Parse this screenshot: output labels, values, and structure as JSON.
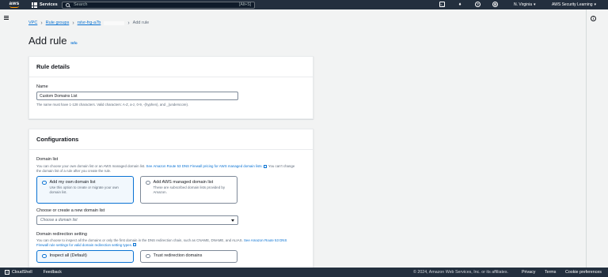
{
  "topnav": {
    "logo": "aws",
    "services": "Services",
    "search_placeholder": "Search",
    "search_shortcut": "[Alt+S]",
    "region": "N. Virginia",
    "account": "AWS Security Learning"
  },
  "breadcrumb": {
    "items": [
      "VPC",
      "Rule groups",
      "rslvr-frg-a7b"
    ],
    "current": "Add rule"
  },
  "page": {
    "title": "Add rule",
    "info": "Info"
  },
  "rule_details": {
    "heading": "Rule details",
    "name_label": "Name",
    "name_value": "Custom Domains List",
    "name_constraint": "The name must have 1-128 characters. Valid characters: A-Z, a-z, 0-9, -(hyphen), and _(underscore)."
  },
  "configurations": {
    "heading": "Configurations",
    "domain_list_label": "Domain list",
    "domain_list_desc_1": "You can choose your own domain list or an AWS managed domain list. ",
    "domain_list_link": "See Amazon Route 53 DNS Firewall pricing for AWS managed domain lists.",
    "domain_list_desc_2": " You can't change the domain list of a rule after you create the rule.",
    "own_list_label": "Add my own domain list",
    "own_list_desc": "Use this option to create or migrate your own domain list.",
    "managed_list_label": "Add AWS managed domain list",
    "managed_list_desc": "These are subscribed domain lists provided by Amazon.",
    "choose_label": "Choose or create a new domain list",
    "choose_placeholder": "Choose a domain list",
    "redirection_label": "Domain redirection setting",
    "redirection_desc_1": "You can choose to inspect all the domains or only the first domain in the DNS redirection chain, such as CNAME, DNAME, and ALIAS. ",
    "redirection_link": "See Amazon Route 53 DNS Firewall rule settings for valid domain redirection setting types.",
    "inspect_all": "Inspect all (Default)",
    "trust_redirection": "Trust redirection domains"
  },
  "footer": {
    "cloudshell": "CloudShell",
    "feedback": "Feedback",
    "copyright": "© 2024, Amazon Web Services, Inc. or its affiliates.",
    "privacy": "Privacy",
    "terms": "Terms",
    "cookie": "Cookie preferences"
  }
}
